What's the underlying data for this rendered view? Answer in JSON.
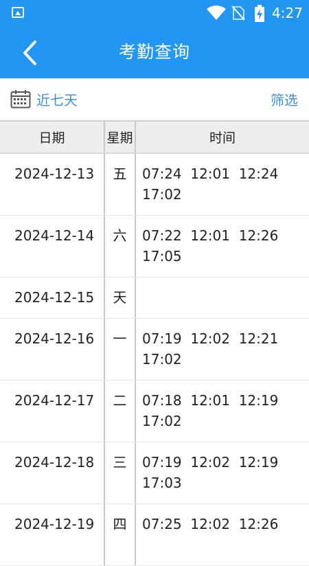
{
  "status_bar": {
    "time": "4:27",
    "icons": [
      "image-notification-icon",
      "wifi-icon",
      "no-sim-icon",
      "battery-charging-icon"
    ]
  },
  "header": {
    "title": "考勤查询",
    "back_icon": "chevron-left-icon",
    "background": "#2196F3"
  },
  "filter_bar": {
    "range_label": "近七天",
    "filter_label": "筛选",
    "calendar_icon": "calendar-icon",
    "accent": "#3d8fe0"
  },
  "table": {
    "headers": [
      "日期",
      "星期",
      "时间"
    ],
    "rows": [
      {
        "date": "2024-12-13",
        "weekday": "五",
        "times": "07:24  12:01  12:24\n17:02"
      },
      {
        "date": "2024-12-14",
        "weekday": "六",
        "times": "07:22  12:01  12:26\n17:05"
      },
      {
        "date": "2024-12-15",
        "weekday": "天",
        "times": ""
      },
      {
        "date": "2024-12-16",
        "weekday": "一",
        "times": "07:19  12:02  12:21\n17:02"
      },
      {
        "date": "2024-12-17",
        "weekday": "二",
        "times": "07:18  12:01  12:19\n17:02"
      },
      {
        "date": "2024-12-18",
        "weekday": "三",
        "times": "07:19  12:02  12:19\n17:03"
      },
      {
        "date": "2024-12-19",
        "weekday": "四",
        "times": "07:25  12:02  12:26"
      }
    ]
  }
}
